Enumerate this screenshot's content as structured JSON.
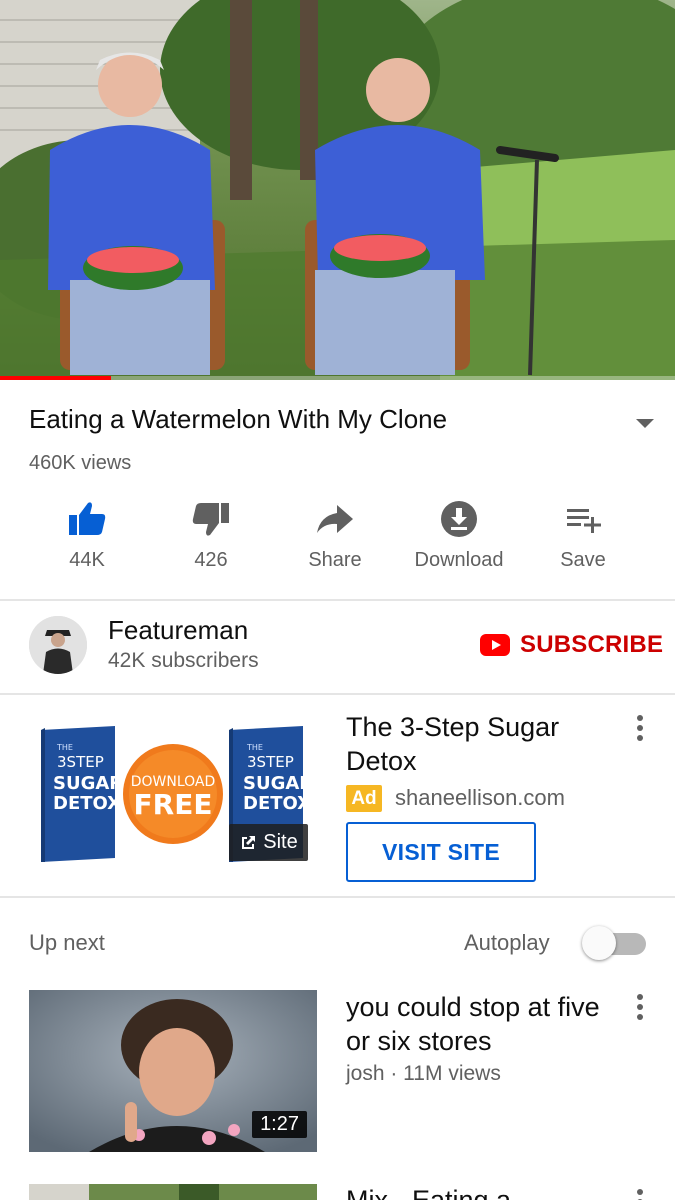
{
  "player": {
    "progress_fraction": 0.165,
    "progress_color": "#ff0000"
  },
  "video": {
    "title": "Eating a Watermelon With My Clone",
    "views": "460K views"
  },
  "actions": [
    {
      "icon": "thumb-up-icon",
      "label": "44K"
    },
    {
      "icon": "thumb-down-icon",
      "label": "426"
    },
    {
      "icon": "share-icon",
      "label": "Share"
    },
    {
      "icon": "download-icon",
      "label": "Download"
    },
    {
      "icon": "playlist-add-icon",
      "label": "Save"
    }
  ],
  "channel": {
    "name": "Featureman",
    "subscribers": "42K subscribers",
    "subscribe_label": "SUBSCRIBE"
  },
  "ad": {
    "title": "The 3-Step Sugar Detox",
    "badge": "Ad",
    "domain": "shaneellison.com",
    "cta": "VISIT SITE",
    "site_chip": "Site",
    "image_text": {
      "book_small": "THE",
      "book_line1": "3STEP",
      "book_line2": "SUGAR",
      "book_line3": "DETOX",
      "badge_line1": "DOWNLOAD",
      "badge_line2": "FREE"
    }
  },
  "up_next": {
    "label": "Up next",
    "autoplay_label": "Autoplay",
    "autoplay_on": false
  },
  "recommendations": [
    {
      "title": "you could stop at five or six stores",
      "meta": "josh · 11M views",
      "duration": "1:27"
    },
    {
      "title": "Mix - Eating a",
      "meta": "",
      "duration": ""
    }
  ],
  "colors": {
    "accent_red": "#cc0000",
    "link_blue": "#065fd4",
    "like_blue": "#065fd4",
    "ad_badge": "#f6b723",
    "secondary_text": "#606060"
  }
}
